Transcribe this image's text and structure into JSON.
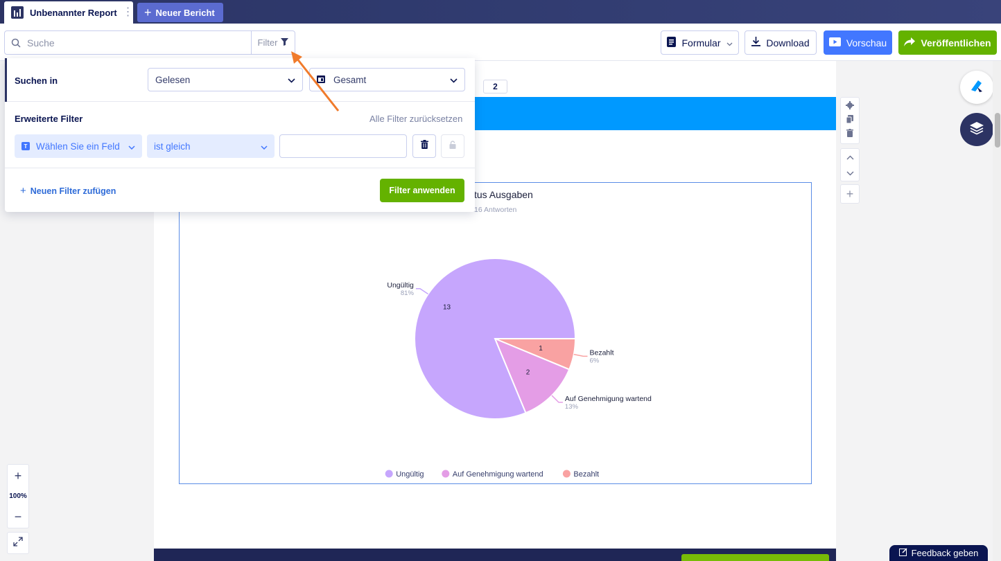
{
  "header": {
    "report_tab": "Unbenannter Report",
    "new_report": "Neuer Bericht"
  },
  "toolbar": {
    "search_placeholder": "Suche",
    "filter_label": "Filter",
    "form_label": "Formular",
    "download_label": "Download",
    "preview_label": "Vorschau",
    "publish_label": "Veröffentlichen"
  },
  "filter_panel": {
    "search_in_label": "Suchen in",
    "read_select": "Gelesen",
    "total_select": "Gesamt",
    "advanced_label": "Erweiterte Filter",
    "reset_label": "Alle Filter zurücksetzen",
    "field_select": "Wählen Sie ein Feld",
    "operator_select": "ist gleich",
    "value": "",
    "add_filter": "Neuen Filter zufügen",
    "apply": "Filter anwenden"
  },
  "page": {
    "page_number": "2"
  },
  "chart_data": {
    "type": "pie",
    "title": "tus Ausgaben",
    "subtitle": "16 Antworten",
    "categories": [
      "Ungültig",
      "Auf Genehmigung wartend",
      "Bezahlt"
    ],
    "values": [
      13,
      2,
      1
    ],
    "percent_labels": [
      "81%",
      "13%",
      "6%"
    ],
    "colors": [
      "#c6a6fd",
      "#e49de6",
      "#f9a2a2"
    ],
    "legend": "bottom"
  },
  "zoom": {
    "level": "100%"
  },
  "feedback": "Feedback geben"
}
